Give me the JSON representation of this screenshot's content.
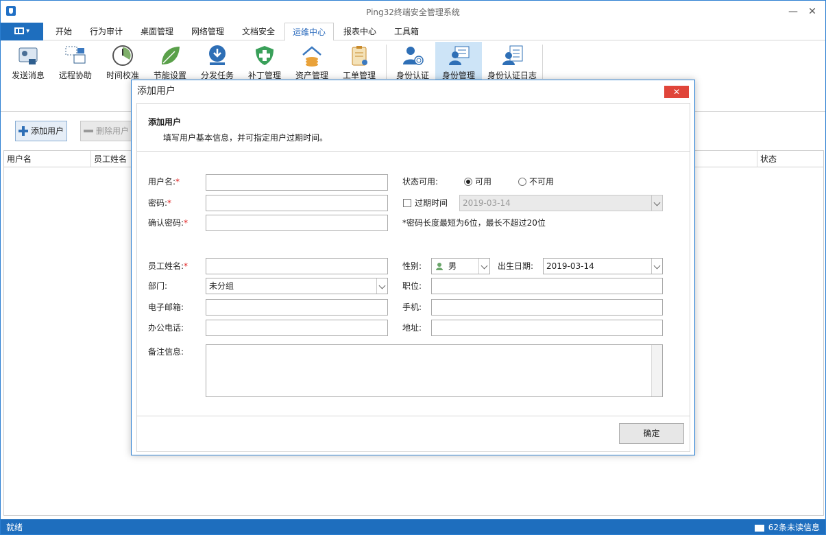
{
  "window": {
    "title": "Ping32终端安全管理系统",
    "min": "—",
    "close": "✕"
  },
  "menu": {
    "items": [
      "开始",
      "行为审计",
      "桌面管理",
      "网络管理",
      "文档安全",
      "运维中心",
      "报表中心",
      "工具箱"
    ],
    "active": "运维中心"
  },
  "ribbon": {
    "buttons": [
      "发送消息",
      "远程协助",
      "时间校准",
      "节能设置",
      "分发任务",
      "补丁管理",
      "资产管理",
      "工单管理",
      "身份认证",
      "身份管理",
      "身份认证日志"
    ],
    "selected": "身份管理"
  },
  "toolbar": {
    "add_user": "添加用户",
    "delete_user": "删除用户"
  },
  "grid": {
    "columns": [
      "用户名",
      "员工姓名",
      "状态"
    ]
  },
  "status": {
    "left": "就绪",
    "right": "62条未读信息"
  },
  "dialog": {
    "title": "添加用户",
    "close": "✕",
    "header_title": "添加用户",
    "header_sub": "填写用户基本信息，并可指定用户过期时间。",
    "labels": {
      "username": "用户名:",
      "password": "密码:",
      "confirm_password": "确认密码:",
      "employee_name": "员工姓名:",
      "department": "部门:",
      "email": "电子邮箱:",
      "office_phone": "办公电话:",
      "remarks": "备注信息:",
      "status": "状态可用:",
      "expire": "过期时间",
      "gender": "性别:",
      "birthdate": "出生日期:",
      "position": "职位:",
      "mobile": "手机:",
      "address": "地址:"
    },
    "required_mark": "*",
    "status_options": [
      "可用",
      "不可用"
    ],
    "status_selected": "可用",
    "expire_date": "2019-03-14",
    "password_hint": "*密码长度最短为6位，最长不超过20位",
    "gender_value": "男",
    "birthdate_value": "2019-03-14",
    "department_value": "未分组",
    "ok": "确定"
  },
  "colors": {
    "accent": "#1e6ebe",
    "close_red": "#e0453a",
    "required": "#e02020"
  }
}
